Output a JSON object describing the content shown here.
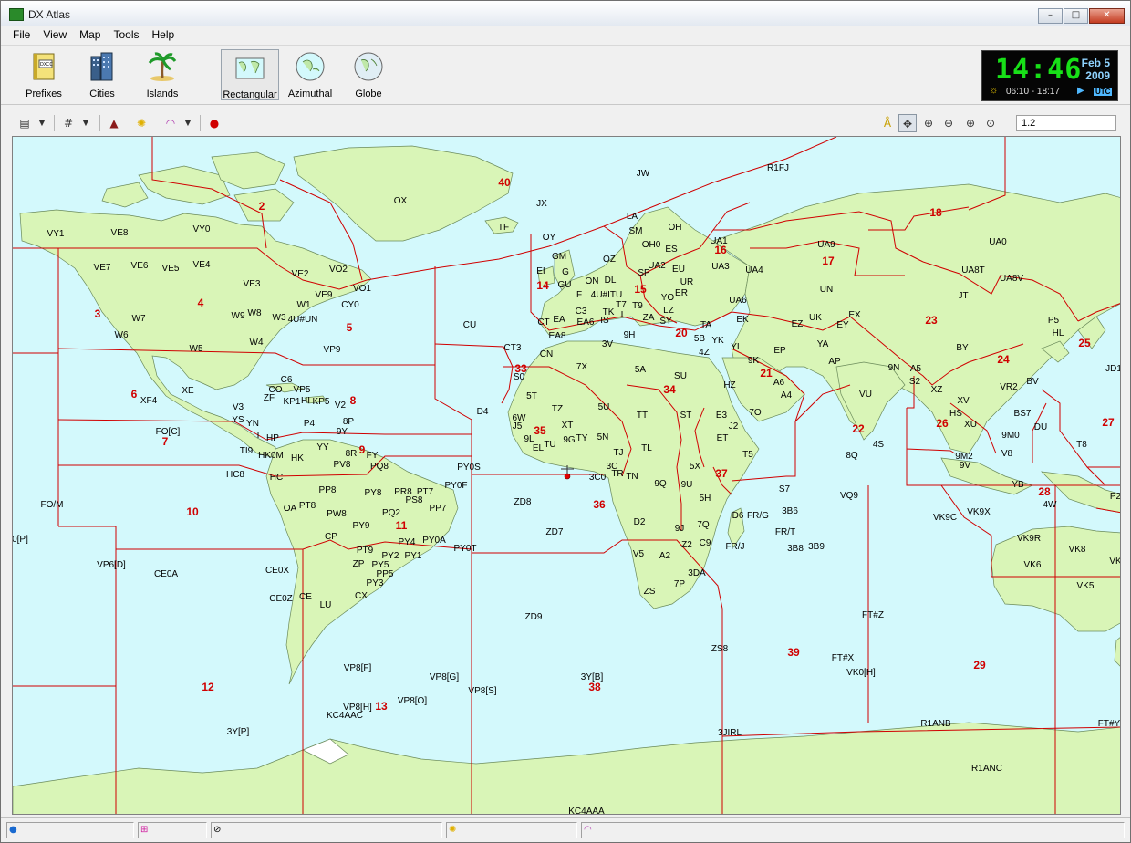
{
  "window": {
    "title": "DX Atlas",
    "minimize": "–",
    "maximize": "□",
    "close": "✕"
  },
  "menu": [
    "File",
    "View",
    "Map",
    "Tools",
    "Help"
  ],
  "toolbar": {
    "buttons": [
      {
        "id": "prefixes",
        "label": "Prefixes",
        "icon": "dxcc-book-icon"
      },
      {
        "id": "cities",
        "label": "Cities",
        "icon": "buildings-icon"
      },
      {
        "id": "islands",
        "label": "Islands",
        "icon": "palm-tree-icon"
      },
      {
        "id": "rectangular",
        "label": "Rectangular",
        "icon": "rectangular-map-icon",
        "active": true
      },
      {
        "id": "azimuthal",
        "label": "Azimuthal",
        "icon": "azimuthal-map-icon"
      },
      {
        "id": "globe",
        "label": "Globe",
        "icon": "globe-icon"
      }
    ]
  },
  "clock": {
    "time": "14:46",
    "date_day": "Feb 5",
    "date_year": "2009",
    "sun_range": "06:10 - 18:17",
    "utc": "UTC"
  },
  "toolbar2": {
    "scale": "1.2"
  },
  "map": {
    "prefixes": [
      [
        "OX",
        437,
        218
      ],
      [
        "JX",
        592,
        221
      ],
      [
        "TF",
        550,
        247
      ],
      [
        "OY",
        600,
        258
      ],
      [
        "JW",
        703,
        188
      ],
      [
        "R1FJ",
        851,
        182
      ],
      [
        "VY1",
        59,
        254
      ],
      [
        "VE8",
        129,
        253
      ],
      [
        "VY0",
        219,
        249
      ],
      [
        "VE7",
        110,
        291
      ],
      [
        "VE6",
        151,
        289
      ],
      [
        "VE5",
        185,
        292
      ],
      [
        "VE4",
        219,
        288
      ],
      [
        "VE2",
        327,
        298
      ],
      [
        "VO2",
        369,
        293
      ],
      [
        "VE3",
        274,
        309
      ],
      [
        "VE9",
        353,
        321
      ],
      [
        "VO1",
        395,
        314
      ],
      [
        "CY0",
        382,
        332
      ],
      [
        "W1",
        331,
        332
      ],
      [
        "W7",
        150,
        347
      ],
      [
        "W9",
        259,
        344
      ],
      [
        "W8",
        277,
        341
      ],
      [
        "W3",
        304,
        346
      ],
      [
        "4U#UN",
        330,
        348
      ],
      [
        "W6",
        131,
        365
      ],
      [
        "W5",
        213,
        380
      ],
      [
        "W4",
        279,
        373
      ],
      [
        "VP9",
        362,
        381
      ],
      [
        "XF4",
        161,
        437
      ],
      [
        "XE",
        204,
        426
      ],
      [
        "C6",
        312,
        414
      ],
      [
        "CO",
        300,
        425
      ],
      [
        "VP5",
        329,
        425
      ],
      [
        "ZF",
        293,
        434
      ],
      [
        "KP1",
        318,
        438
      ],
      [
        "HI",
        333,
        437
      ],
      [
        "KP5",
        350,
        438
      ],
      [
        "V2",
        371,
        442
      ],
      [
        "V3",
        259,
        444
      ],
      [
        "YS",
        259,
        458
      ],
      [
        "YN",
        275,
        462
      ],
      [
        "8P",
        380,
        460
      ],
      [
        "P4",
        337,
        462
      ],
      [
        "9Y",
        373,
        471
      ],
      [
        "FO[C]",
        182,
        471
      ],
      [
        "TI",
        278,
        475
      ],
      [
        "HP",
        297,
        478
      ],
      [
        "YY",
        352,
        488
      ],
      [
        "8R",
        383,
        495
      ],
      [
        "FY",
        406,
        497
      ],
      [
        "TI9",
        268,
        492
      ],
      [
        "HK0M",
        295,
        497
      ],
      [
        "HK",
        324,
        500
      ],
      [
        "PV8",
        373,
        507
      ],
      [
        "PQ8",
        414,
        509
      ],
      [
        "PY0S",
        512,
        510
      ],
      [
        "PY0F",
        498,
        530
      ],
      [
        "HC8",
        256,
        518
      ],
      [
        "HC",
        301,
        521
      ],
      [
        "PP8",
        357,
        535
      ],
      [
        "PY8",
        407,
        538
      ],
      [
        "PR8",
        440,
        537
      ],
      [
        "PT7",
        464,
        537
      ],
      [
        "PS8",
        452,
        546
      ],
      [
        "PP7",
        478,
        555
      ],
      [
        "FO/M",
        55,
        551
      ],
      [
        "OA",
        316,
        555
      ],
      [
        "PT8",
        335,
        552
      ],
      [
        "PW8",
        367,
        561
      ],
      [
        "PQ2",
        427,
        560
      ],
      [
        "PY9",
        394,
        574
      ],
      [
        "CP",
        361,
        586
      ],
      [
        "PY4",
        444,
        592
      ],
      [
        "PY0A",
        474,
        590
      ],
      [
        "PT9",
        398,
        601
      ],
      [
        "PY0T",
        508,
        599
      ],
      [
        "PY2",
        426,
        607
      ],
      [
        "PY1",
        451,
        607
      ],
      [
        "ZP",
        391,
        616
      ],
      [
        "PY5",
        415,
        617
      ],
      [
        "PP5",
        420,
        627
      ],
      [
        "PY3",
        409,
        637
      ],
      [
        "VP6[D]",
        120,
        617
      ],
      [
        "CE0A",
        180,
        627
      ],
      [
        "CE0X",
        302,
        623
      ],
      [
        "CE0Z",
        306,
        654
      ],
      [
        "CE",
        333,
        652
      ],
      [
        "CX",
        394,
        651
      ],
      [
        "LU",
        355,
        661
      ],
      [
        "VP8[F]",
        390,
        730
      ],
      [
        "VP8[G]",
        485,
        740
      ],
      [
        "VP8[S]",
        527,
        755
      ],
      [
        "VP8[H]",
        390,
        773
      ],
      [
        "VP8[O]",
        450,
        766
      ],
      [
        "KC4AAC",
        376,
        782
      ],
      [
        "3Y[P]",
        259,
        800
      ],
      [
        "ZD8",
        571,
        548
      ],
      [
        "ZD7",
        606,
        581
      ],
      [
        "ZD9",
        583,
        674
      ],
      [
        "3Y[B]",
        647,
        740
      ],
      [
        "CT3",
        560,
        379
      ],
      [
        "CU",
        513,
        354
      ],
      [
        "D4",
        527,
        449
      ],
      [
        "GM",
        611,
        279
      ],
      [
        "EI",
        591,
        295
      ],
      [
        "G",
        618,
        296
      ],
      [
        "GU",
        617,
        310
      ],
      [
        "F",
        633,
        321
      ],
      [
        "ON",
        647,
        306
      ],
      [
        "OZ",
        666,
        282
      ],
      [
        "DL",
        667,
        305
      ],
      [
        "SP",
        704,
        297
      ],
      [
        "SM",
        695,
        251
      ],
      [
        "LA",
        691,
        235
      ],
      [
        "OH0",
        712,
        266
      ],
      [
        "OH",
        738,
        247
      ],
      [
        "ES",
        734,
        271
      ],
      [
        "UA1",
        786,
        262
      ],
      [
        "UA2",
        718,
        289
      ],
      [
        "EU",
        742,
        293
      ],
      [
        "UR",
        751,
        307
      ],
      [
        "UA3",
        788,
        290
      ],
      [
        "UA4",
        825,
        294
      ],
      [
        "4U#ITU",
        663,
        321
      ],
      [
        "YO",
        730,
        324
      ],
      [
        "ER",
        745,
        319
      ],
      [
        "T7",
        679,
        332
      ],
      [
        "T9",
        697,
        333
      ],
      [
        "CT",
        594,
        351
      ],
      [
        "EA",
        611,
        348
      ],
      [
        "C3",
        635,
        339
      ],
      [
        "EA6",
        640,
        351
      ],
      [
        "TK",
        665,
        340
      ],
      [
        "IS",
        661,
        349
      ],
      [
        "I",
        680,
        343
      ],
      [
        "ZA",
        709,
        346
      ],
      [
        "LZ",
        731,
        338
      ],
      [
        "SY",
        728,
        350
      ],
      [
        "UA6",
        807,
        327
      ],
      [
        "EK",
        812,
        348
      ],
      [
        "EA8",
        609,
        366
      ],
      [
        "9H",
        688,
        365
      ],
      [
        "TA",
        772,
        354
      ],
      [
        "5B",
        765,
        369
      ],
      [
        "YK",
        785,
        371
      ],
      [
        "4Z",
        770,
        384
      ],
      [
        "CN",
        597,
        386
      ],
      [
        "3V",
        664,
        375
      ],
      [
        "7X",
        636,
        400
      ],
      [
        "S0",
        567,
        411
      ],
      [
        "5A",
        700,
        403
      ],
      [
        "SU",
        744,
        410
      ],
      [
        "YI",
        804,
        378
      ],
      [
        "9K",
        824,
        393
      ],
      [
        "EP",
        853,
        382
      ],
      [
        "HZ",
        798,
        420
      ],
      [
        "A6",
        852,
        417
      ],
      [
        "A4",
        860,
        431
      ],
      [
        "5T",
        581,
        432
      ],
      [
        "TZ",
        609,
        446
      ],
      [
        "5U",
        660,
        444
      ],
      [
        "6W",
        567,
        456
      ],
      [
        "J5",
        565,
        465
      ],
      [
        "XT",
        620,
        464
      ],
      [
        "9G",
        622,
        480
      ],
      [
        "TY",
        636,
        478
      ],
      [
        "5N",
        659,
        477
      ],
      [
        "9L",
        578,
        479
      ],
      [
        "EL",
        588,
        489
      ],
      [
        "TU",
        601,
        485
      ],
      [
        "TT",
        702,
        453
      ],
      [
        "ST",
        750,
        453
      ],
      [
        "E3",
        789,
        453
      ],
      [
        "7O",
        826,
        450
      ],
      [
        "J2",
        802,
        465
      ],
      [
        "ET",
        790,
        478
      ],
      [
        "TL",
        707,
        489
      ],
      [
        "TJ",
        676,
        494
      ],
      [
        "3C",
        669,
        509
      ],
      [
        "3C0",
        653,
        521
      ],
      [
        "TR",
        675,
        517
      ],
      [
        "TN",
        691,
        520
      ],
      [
        "5X",
        760,
        509
      ],
      [
        "9U",
        751,
        529
      ],
      [
        "T5",
        818,
        496
      ],
      [
        "5H",
        771,
        544
      ],
      [
        "9Q",
        722,
        528
      ],
      [
        "D2",
        699,
        570
      ],
      [
        "9J",
        743,
        577
      ],
      [
        "7Q",
        769,
        573
      ],
      [
        "C9",
        771,
        593
      ],
      [
        "Z2",
        751,
        595
      ],
      [
        "V5",
        698,
        605
      ],
      [
        "A2",
        727,
        607
      ],
      [
        "ZS",
        710,
        646
      ],
      [
        "7P",
        743,
        638
      ],
      [
        "3DA",
        762,
        626
      ],
      [
        "D6",
        807,
        563
      ],
      [
        "FR/G",
        829,
        563
      ],
      [
        "3B6",
        864,
        558
      ],
      [
        "FR/T",
        859,
        581
      ],
      [
        "3B8",
        870,
        599
      ],
      [
        "3B9",
        893,
        597
      ],
      [
        "FR/J",
        804,
        597
      ],
      [
        "S7",
        858,
        534
      ],
      [
        "ZS8",
        787,
        709
      ],
      [
        "UA9",
        904,
        266
      ],
      [
        "UA0",
        1092,
        263
      ],
      [
        "UA8T",
        1065,
        294
      ],
      [
        "UA8V",
        1107,
        303
      ],
      [
        "UN",
        904,
        315
      ],
      [
        "JT",
        1054,
        322
      ],
      [
        "EZ",
        872,
        353
      ],
      [
        "UK",
        892,
        346
      ],
      [
        "EX",
        935,
        343
      ],
      [
        "EY",
        922,
        354
      ],
      [
        "YA",
        900,
        375
      ],
      [
        "AP",
        913,
        394
      ],
      [
        "9N",
        978,
        401
      ],
      [
        "A5",
        1002,
        402
      ],
      [
        "S2",
        1001,
        416
      ],
      [
        "VU",
        947,
        430
      ],
      [
        "XZ",
        1025,
        425
      ],
      [
        "XV",
        1054,
        437
      ],
      [
        "BY",
        1053,
        379
      ],
      [
        "VR2",
        1104,
        422
      ],
      [
        "BV",
        1130,
        416
      ],
      [
        "HS",
        1046,
        451
      ],
      [
        "XU",
        1062,
        463
      ],
      [
        "BS7",
        1119,
        451
      ],
      [
        "DU",
        1139,
        466
      ],
      [
        "9M0",
        1106,
        475
      ],
      [
        "4S",
        961,
        485
      ],
      [
        "8Q",
        932,
        497
      ],
      [
        "V8",
        1102,
        495
      ],
      [
        "9M2",
        1055,
        498
      ],
      [
        "9V",
        1056,
        508
      ],
      [
        "T8",
        1184,
        485
      ],
      [
        "YB",
        1114,
        529
      ],
      [
        "VQ9",
        929,
        541
      ],
      [
        "4W",
        1149,
        551
      ],
      [
        "VK9X",
        1071,
        559
      ],
      [
        "VK9C",
        1034,
        565
      ],
      [
        "VK9R",
        1126,
        588
      ],
      [
        "VK8",
        1179,
        600
      ],
      [
        "VK6",
        1130,
        617
      ],
      [
        "VK5",
        1188,
        640
      ],
      [
        "FT#Z",
        955,
        672
      ],
      [
        "FT#X",
        922,
        719
      ],
      [
        "VK0[H]",
        942,
        735
      ],
      [
        "R1ANB",
        1024,
        791
      ],
      [
        "R1ANC",
        1080,
        840
      ],
      [
        "3JIRL",
        798,
        801
      ],
      [
        "KC4AAA",
        641,
        887
      ],
      [
        "P5",
        1153,
        349
      ],
      [
        "HL",
        1158,
        363
      ],
      [
        "JD1",
        1219,
        402
      ],
      [
        "P2",
        1221,
        542
      ],
      [
        "VK",
        1221,
        613
      ],
      [
        "FT#Y",
        1214,
        791
      ],
      [
        "0[P]",
        20,
        589
      ]
    ],
    "zones": [
      [
        "40",
        551,
        198
      ],
      [
        "2",
        285,
        224
      ],
      [
        "18",
        1024,
        231
      ],
      [
        "16",
        788,
        272
      ],
      [
        "17",
        906,
        284
      ],
      [
        "14",
        593,
        311
      ],
      [
        "15",
        700,
        315
      ],
      [
        "4",
        218,
        330
      ],
      [
        "3",
        105,
        342
      ],
      [
        "5",
        381,
        357
      ],
      [
        "23",
        1019,
        349
      ],
      [
        "20",
        745,
        363
      ],
      [
        "25",
        1187,
        374
      ],
      [
        "21",
        838,
        407
      ],
      [
        "24",
        1098,
        392
      ],
      [
        "33",
        569,
        402
      ],
      [
        "34",
        732,
        425
      ],
      [
        "6",
        145,
        430
      ],
      [
        "8",
        385,
        437
      ],
      [
        "22",
        939,
        468
      ],
      [
        "26",
        1031,
        462
      ],
      [
        "27",
        1213,
        461
      ],
      [
        "35",
        590,
        470
      ],
      [
        "7",
        179,
        482
      ],
      [
        "9",
        395,
        491
      ],
      [
        "37",
        789,
        517
      ],
      [
        "28",
        1143,
        537
      ],
      [
        "36",
        655,
        551
      ],
      [
        "10",
        209,
        559
      ],
      [
        "11",
        438,
        574
      ],
      [
        "39",
        868,
        713
      ],
      [
        "29",
        1072,
        727
      ],
      [
        "12",
        226,
        751
      ],
      [
        "38",
        650,
        751
      ],
      [
        "13",
        416,
        772
      ]
    ]
  },
  "status": {
    "cells": [
      "",
      "",
      "",
      "",
      ""
    ]
  }
}
